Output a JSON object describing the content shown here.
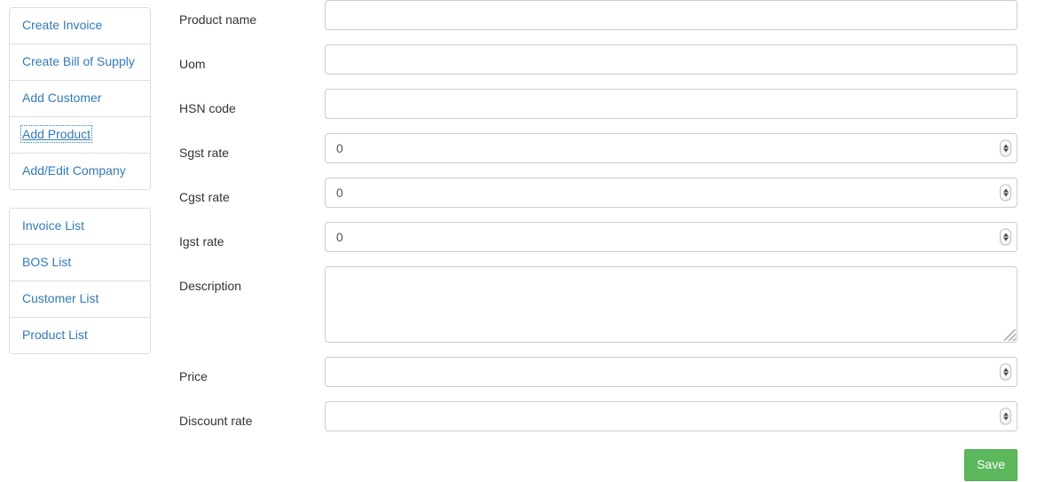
{
  "sidebar": {
    "groups": [
      {
        "name": "actions",
        "items": [
          {
            "label": "Create Invoice",
            "active": false
          },
          {
            "label": "Create Bill of Supply",
            "active": false
          },
          {
            "label": "Add Customer",
            "active": false
          },
          {
            "label": "Add Product",
            "active": true
          },
          {
            "label": "Add/Edit Company",
            "active": false
          }
        ]
      },
      {
        "name": "lists",
        "items": [
          {
            "label": "Invoice List",
            "active": false
          },
          {
            "label": "BOS List",
            "active": false
          },
          {
            "label": "Customer List",
            "active": false
          },
          {
            "label": "Product List",
            "active": false
          }
        ]
      }
    ]
  },
  "form": {
    "fields": [
      {
        "key": "product_name",
        "label": "Product name",
        "type": "text",
        "value": "",
        "placeholder": ""
      },
      {
        "key": "uom",
        "label": "Uom",
        "type": "text",
        "value": "",
        "placeholder": ""
      },
      {
        "key": "hsn_code",
        "label": "HSN code",
        "type": "text",
        "value": "",
        "placeholder": ""
      },
      {
        "key": "sgst_rate",
        "label": "Sgst rate",
        "type": "number",
        "value": "0",
        "placeholder": ""
      },
      {
        "key": "cgst_rate",
        "label": "Cgst rate",
        "type": "number",
        "value": "0",
        "placeholder": ""
      },
      {
        "key": "igst_rate",
        "label": "Igst rate",
        "type": "number",
        "value": "0",
        "placeholder": ""
      },
      {
        "key": "description",
        "label": "Description",
        "type": "textarea",
        "value": "",
        "placeholder": ""
      },
      {
        "key": "price",
        "label": "Price",
        "type": "number",
        "value": "",
        "placeholder": ""
      },
      {
        "key": "discount_rate",
        "label": "Discount rate",
        "type": "number",
        "value": "",
        "placeholder": ""
      }
    ],
    "save_label": "Save"
  },
  "colors": {
    "link": "#337ab7",
    "label_text": "#333333",
    "border": "#dddddd",
    "input_border": "#cccccc",
    "save_bg": "#5cb85c",
    "save_border": "#4cae4c",
    "save_text": "#ffffff"
  }
}
